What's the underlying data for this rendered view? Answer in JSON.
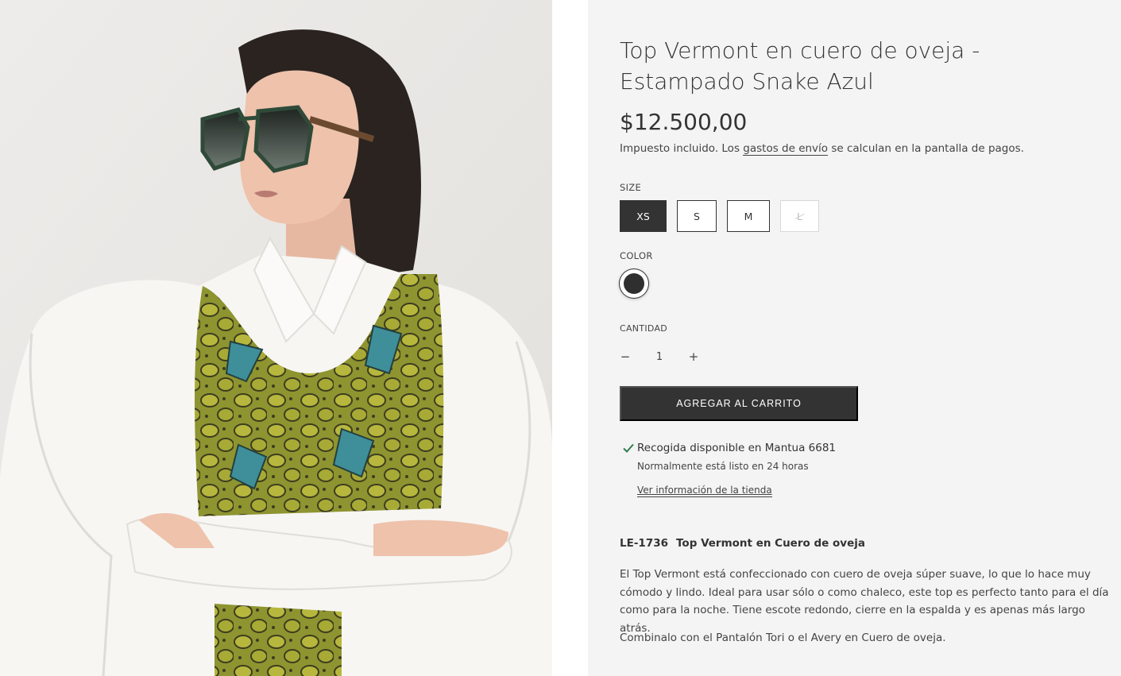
{
  "product": {
    "title": "Top Vermont en cuero de oveja - Estampado Snake Azul",
    "price": "$12.500,00",
    "tax_prefix": "Impuesto incluido. Los ",
    "tax_link": "gastos de envío",
    "tax_suffix": " se calculan en la pantalla de pagos."
  },
  "size": {
    "label": "SIZE",
    "options": [
      "XS",
      "S",
      "M",
      "L"
    ],
    "selected": "XS",
    "unavailable": [
      "L"
    ]
  },
  "color": {
    "label": "COLOR",
    "selected_hex": "#2f2f2f"
  },
  "quantity": {
    "label": "CANTIDAD",
    "minus": "−",
    "value": "1",
    "plus": "+"
  },
  "cart": {
    "button_label": "AGREGAR AL CARRITO"
  },
  "pickup": {
    "title": "Recogida disponible en Mantua 6681",
    "subtitle": "Normalmente está listo en 24 horas",
    "link": "Ver información de la tienda",
    "check_color": "#2e7d4f"
  },
  "description": {
    "sku": "LE-1736",
    "heading": "Top Vermont en Cuero de oveja",
    "body": "El Top Vermont está confeccionado con cuero de oveja súper suave, lo que lo hace muy cómodo y lindo. Ideal para usar sólo o como chaleco, este top es perfecto tanto para el día como para la noche. Tiene escote redondo, cierre en la espalda y es apenas más largo atrás.",
    "extra": "Combinalo con el Pantalón Tori o el Avery en Cuero de oveja."
  },
  "colors": {
    "panel_bg": "#f4f4f4",
    "button_dark": "#333333",
    "text": "#333333"
  }
}
